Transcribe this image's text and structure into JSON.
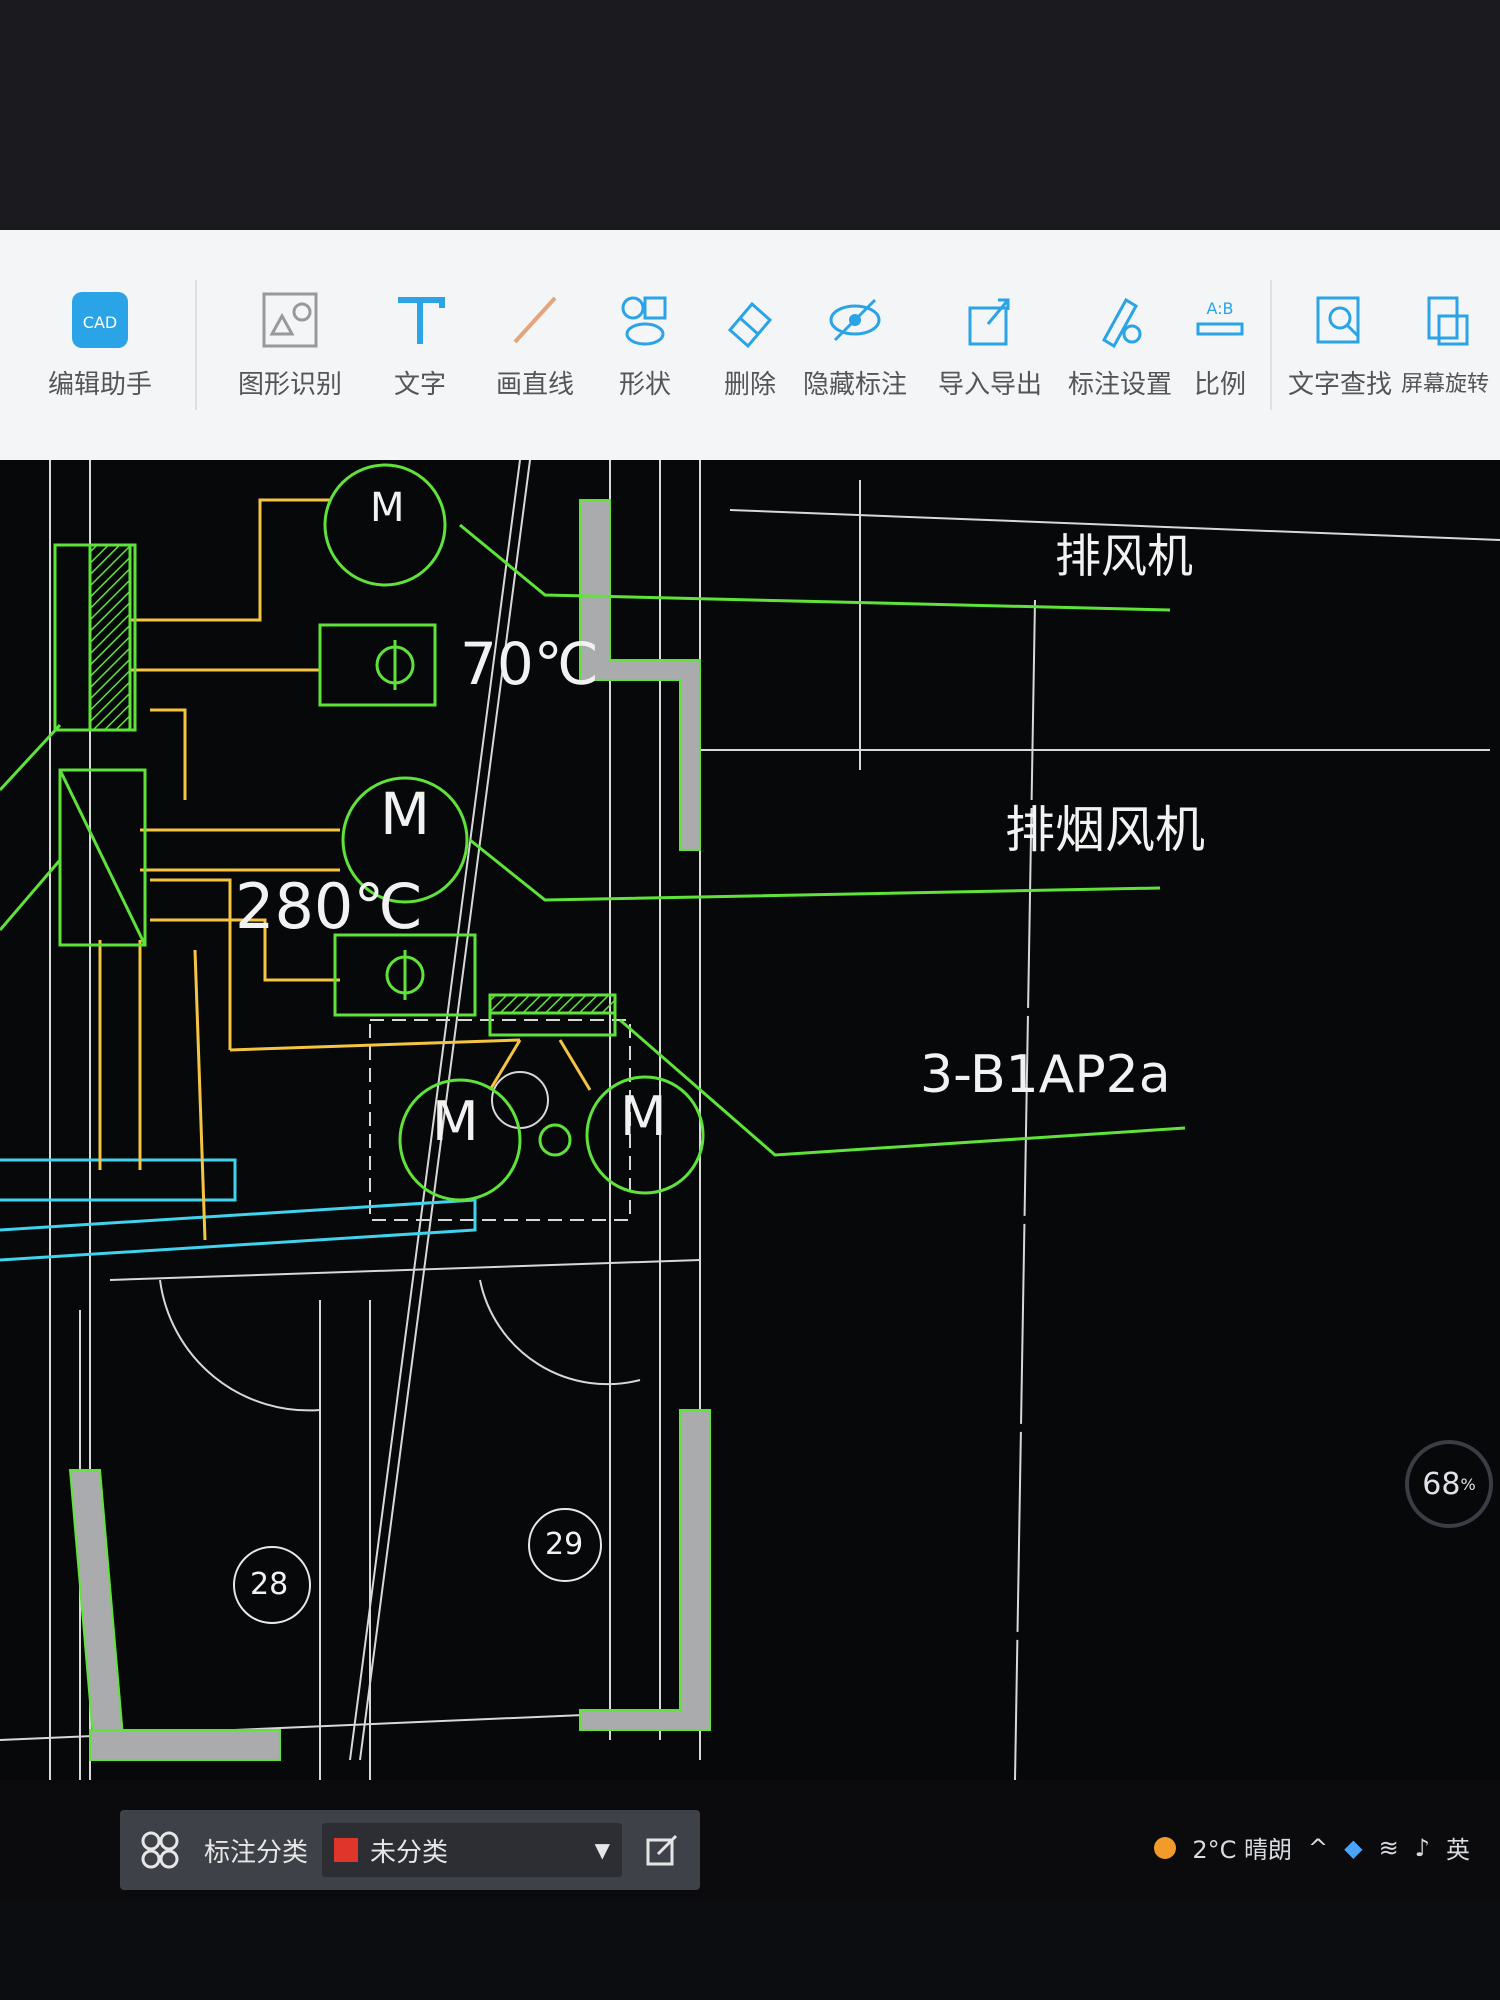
{
  "toolbar": {
    "items": [
      {
        "label": "编辑助手",
        "icon": "cad-assistant-icon"
      },
      {
        "label": "图形识别",
        "icon": "shape-recognition-icon"
      },
      {
        "label": "文字",
        "icon": "text-icon"
      },
      {
        "label": "画直线",
        "icon": "line-icon"
      },
      {
        "label": "形状",
        "icon": "shapes-icon"
      },
      {
        "label": "删除",
        "icon": "eraser-icon"
      },
      {
        "label": "隐藏标注",
        "icon": "hide-eye-icon"
      },
      {
        "label": "导入导出",
        "icon": "import-export-icon"
      },
      {
        "label": "标注设置",
        "icon": "annotation-settings-icon"
      },
      {
        "label": "比例",
        "icon": "scale-icon"
      },
      {
        "label": "文字查找",
        "icon": "text-search-icon"
      },
      {
        "label": "屏幕旋转",
        "icon": "screen-rotate-icon"
      }
    ],
    "cad_badge": "CAD",
    "scale_badge": "A:B"
  },
  "drawing": {
    "label_exhaust_fan": "排风机",
    "label_smoke_exhaust_fan": "排烟风机",
    "label_equipment_code": "3-B1AP2a",
    "temp_70": "70℃",
    "temp_280": "280℃",
    "motor_symbol": "M",
    "room_28": "28",
    "room_29": "29"
  },
  "zoom": {
    "value": "68",
    "unit": "%"
  },
  "status": {
    "category_label": "标注分类",
    "category_value": "未分类",
    "category_color": "#e0352b"
  },
  "tray": {
    "weather": "2°C 晴朗",
    "ime": "英"
  },
  "colors": {
    "cad_green": "#5fe33a",
    "cad_yellow": "#f5c542",
    "cad_cyan": "#3fd3f0",
    "cad_white": "#e8e8e8",
    "accent_blue": "#2aa4e6"
  }
}
